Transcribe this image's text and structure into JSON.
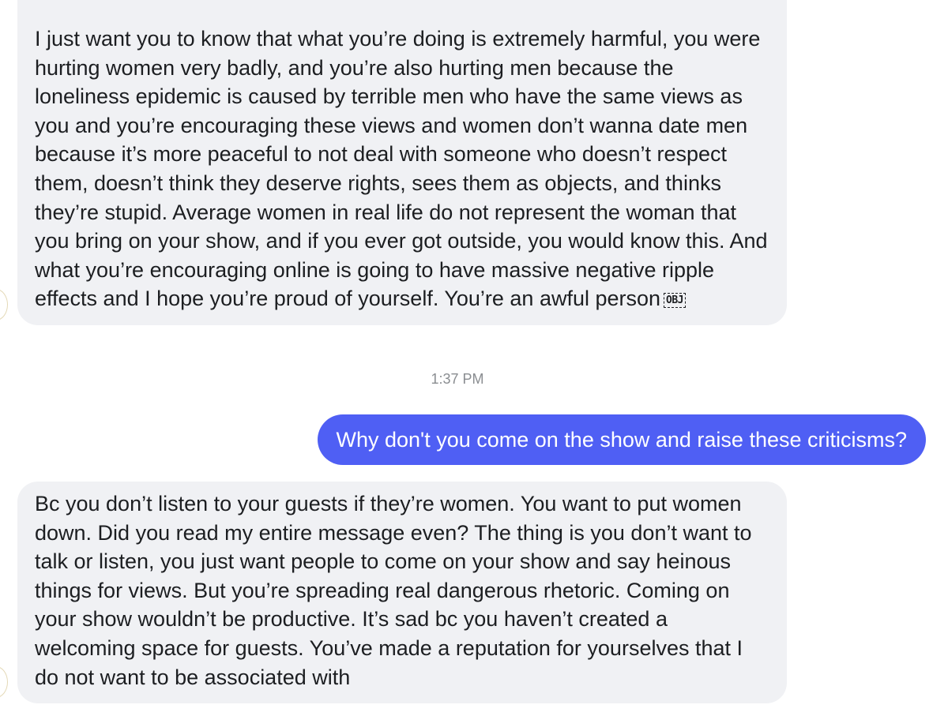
{
  "messages": [
    {
      "side": "incoming",
      "text": "I just want you to know that what you’re doing is extremely harmful, you were hurting women very badly, and you’re also hurting men because the loneliness epidemic is caused by terrible men who have the same views as you and you’re encouraging these views and women don’t wanna date men because it’s more peaceful to not deal with someone who doesn’t respect them, doesn’t think they deserve rights, sees them as objects, and thinks they’re stupid. Average women in real life do not represent the woman that you bring on your show, and if you ever got outside, you would know this. And what you’re encouraging online is going to have massive negative ripple effects and I hope you’re proud of yourself. You’re an awful person",
      "placeholder_glyph": "OBJ"
    },
    {
      "side": "outgoing",
      "text": "Why don't you come on the show and raise these criticisms?"
    },
    {
      "side": "incoming",
      "text": "Bc you don’t listen to your guests if they’re women. You want to put women down. Did you read my entire message even? The thing is you don’t want to talk or listen, you just want people to come on your show and say heinous things for views. But you’re spreading real dangerous rhetoric. Coming on your show wouldn’t be productive. It’s sad bc you haven’t created a welcoming space for guests. You’ve made a reputation for yourselves that I do not want to be associated with"
    }
  ],
  "timestamp": "1:37 PM",
  "colors": {
    "incoming_bubble": "#f0f1f4",
    "outgoing_bubble": "#4f5ff4",
    "incoming_text": "#1c1e21",
    "outgoing_text": "#ffffff",
    "timestamp_text": "#8a8d91"
  }
}
